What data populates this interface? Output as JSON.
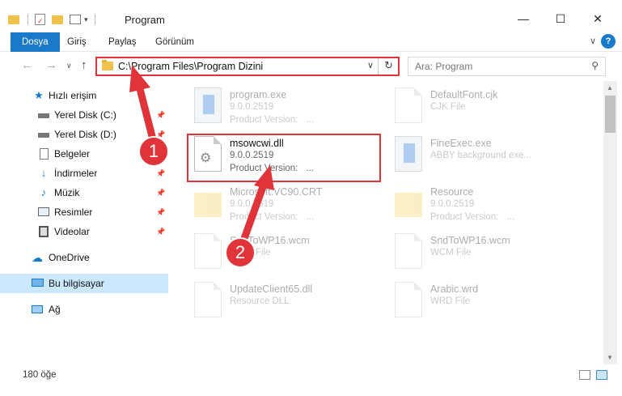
{
  "window": {
    "title": "Program",
    "minimize": "—",
    "maximize": "☐",
    "close": "✕"
  },
  "ribbon": {
    "tabs": [
      "Dosya",
      "Giriş",
      "Paylaş",
      "Görünüm"
    ],
    "help": "?"
  },
  "address": {
    "path": "C:\\Program Files\\Program Dizini",
    "dropdown": "∨",
    "refresh": "↻"
  },
  "search": {
    "placeholder": "Ara: Program"
  },
  "sidebar": {
    "items": [
      {
        "label": "Hızlı erişim",
        "icon": "star-icon"
      },
      {
        "label": "Yerel Disk (C:)",
        "icon": "drive-icon"
      },
      {
        "label": "Yerel Disk (D:)",
        "icon": "drive-icon"
      },
      {
        "label": "Belgeler",
        "icon": "documents-icon"
      },
      {
        "label": "İndirmeler",
        "icon": "download-icon"
      },
      {
        "label": "Müzik",
        "icon": "music-icon"
      },
      {
        "label": "Resimler",
        "icon": "pictures-icon"
      },
      {
        "label": "Videolar",
        "icon": "videos-icon"
      },
      {
        "label": "OneDrive",
        "icon": "cloud-icon"
      },
      {
        "label": "Bu bilgisayar",
        "icon": "computer-icon"
      },
      {
        "label": "Ağ",
        "icon": "network-icon"
      }
    ]
  },
  "files": [
    {
      "name": "program.exe",
      "meta1": "9.0.0.2519",
      "meta2": "Product Version:",
      "meta2b": "...",
      "dim": true
    },
    {
      "name": "DefaultFont.cjk",
      "meta1": "CJK File",
      "meta2": "",
      "meta2b": "",
      "dim": true
    },
    {
      "name": "msowcwi.dll",
      "meta1": "9.0.0.2519",
      "meta2": "Product Version:",
      "meta2b": "...",
      "dim": false
    },
    {
      "name": "FineExec.exe",
      "meta1": "ABBY background exe...",
      "meta2": "",
      "meta2b": "",
      "dim": true
    },
    {
      "name": "Microsoft.VC90.CRT",
      "meta1": "9.0.0.2519",
      "meta2": "Product Version:",
      "meta2b": "...",
      "dim": true
    },
    {
      "name": "Resource",
      "meta1": "9.0.0.2519",
      "meta2": "Product Version:",
      "meta2b": "...",
      "dim": true
    },
    {
      "name": "SndToWP16.wcm",
      "meta1": "WCM File",
      "meta2": "",
      "meta2b": "",
      "dim": true
    },
    {
      "name": "SndToWP16.wcm",
      "meta1": "WCM File",
      "meta2": "",
      "meta2b": "",
      "dim": true
    },
    {
      "name": "UpdateClient65.dll",
      "meta1": "Resource DLL",
      "meta2": "",
      "meta2b": "",
      "dim": true
    },
    {
      "name": "Arabic.wrd",
      "meta1": "WRD File",
      "meta2": "",
      "meta2b": "",
      "dim": true
    }
  ],
  "annotations": {
    "badge1": "1",
    "badge2": "2",
    "accent": "#e0343a"
  },
  "status": {
    "count": "180 öğe"
  }
}
